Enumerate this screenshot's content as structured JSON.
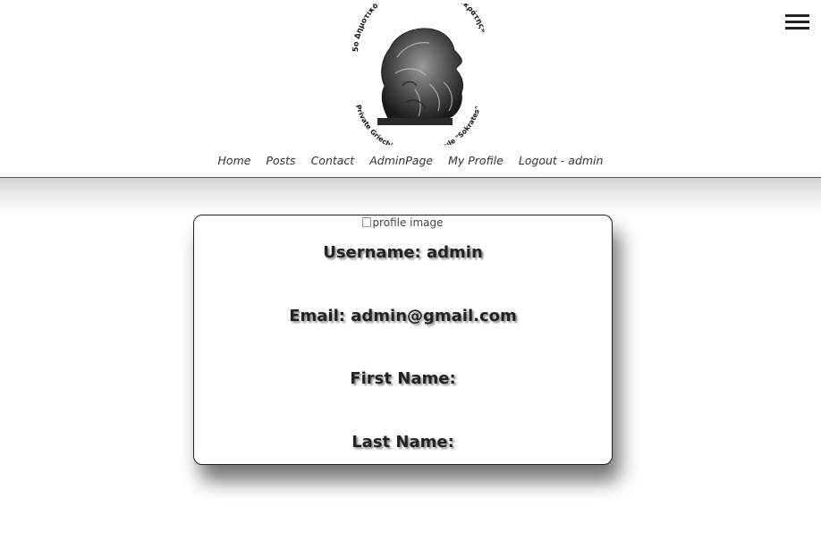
{
  "header": {
    "logo": {
      "top_text": "5ο Δημοτικό Σχολείο Μονάχου «Σωκράτης»",
      "bottom_text": "Private Griechische Grundschule \"Sokrates\""
    },
    "menu_icon": "hamburger-icon"
  },
  "nav": {
    "items": [
      {
        "label": "Home"
      },
      {
        "label": "Posts"
      },
      {
        "label": "Contact"
      },
      {
        "label": "AdminPage"
      },
      {
        "label": "My Profile"
      },
      {
        "label": "Logout - admin"
      }
    ]
  },
  "profile": {
    "image_alt": "profile image",
    "username": "Username: admin",
    "email": "Email: admin@gmail.com",
    "first_name": "First Name:",
    "last_name": "Last Name:"
  }
}
